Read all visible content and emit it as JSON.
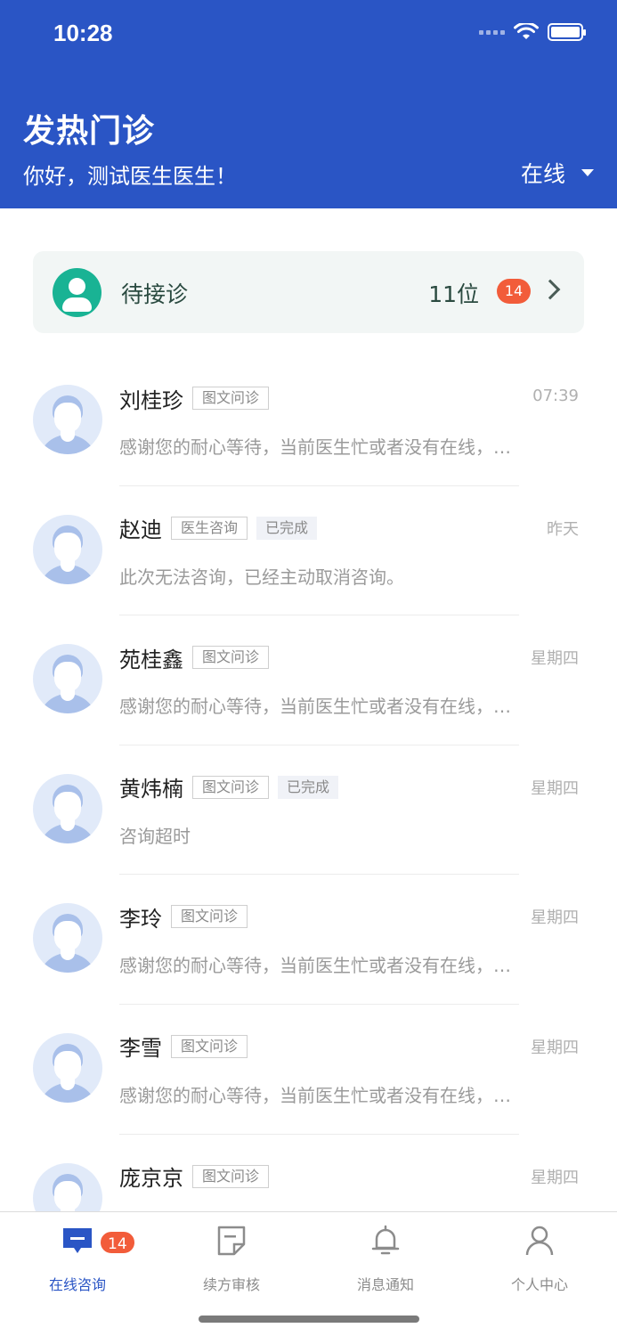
{
  "status_bar": {
    "time": "10:28"
  },
  "header": {
    "title": "发热门诊",
    "greeting": "你好，测试医生医生！",
    "status": "在线"
  },
  "pending": {
    "label": "待接诊",
    "count": "11位",
    "badge": "14"
  },
  "consultations": [
    {
      "name": "刘桂珍",
      "type": "图文问诊",
      "status": "",
      "time": "07:39",
      "message": "感谢您的耐心等待，当前医生忙或者没有在线，请您稍后"
    },
    {
      "name": "赵迪",
      "type": "医生咨询",
      "status": "已完成",
      "time": "昨天",
      "message": "此次无法咨询，已经主动取消咨询。"
    },
    {
      "name": "苑桂鑫",
      "type": "图文问诊",
      "status": "",
      "time": "星期四",
      "message": "感谢您的耐心等待，当前医生忙或者没有在线，请您稍后"
    },
    {
      "name": "黄炜楠",
      "type": "图文问诊",
      "status": "已完成",
      "time": "星期四",
      "message": "咨询超时"
    },
    {
      "name": "李玲",
      "type": "图文问诊",
      "status": "",
      "time": "星期四",
      "message": "感谢您的耐心等待，当前医生忙或者没有在线，请您稍后"
    },
    {
      "name": "李雪",
      "type": "图文问诊",
      "status": "",
      "time": "星期四",
      "message": "感谢您的耐心等待，当前医生忙或者没有在线，请您稍后"
    },
    {
      "name": "庞京京",
      "type": "图文问诊",
      "status": "",
      "time": "星期四",
      "message": ""
    }
  ],
  "tabbar": {
    "tabs": [
      {
        "label": "在线咨询",
        "icon": "chat-icon",
        "active": true,
        "badge": "14"
      },
      {
        "label": "续方审核",
        "icon": "prescription-icon",
        "active": false
      },
      {
        "label": "消息通知",
        "icon": "bell-icon",
        "active": false
      },
      {
        "label": "个人中心",
        "icon": "user-icon",
        "active": false
      }
    ]
  },
  "colors": {
    "primary": "#2a55c5",
    "badge": "#f25c3a",
    "pending_avatar": "#19b394"
  }
}
